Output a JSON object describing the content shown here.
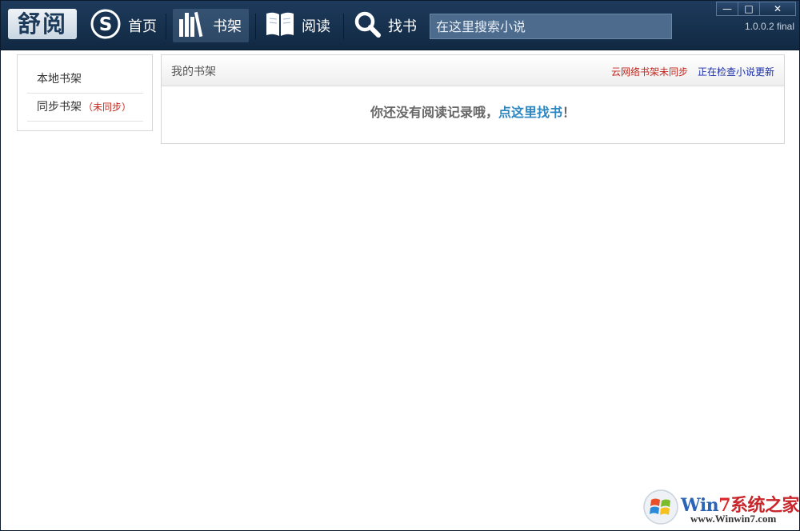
{
  "app": {
    "logo_text": "舒阅",
    "version": "1.0.0.2 final"
  },
  "nav": {
    "home": "首页",
    "shelf": "书架",
    "read": "阅读",
    "find": "找书"
  },
  "search": {
    "placeholder": "在这里搜索小说"
  },
  "window_controls": {
    "minimize": "—",
    "maximize": "□",
    "close": "✕"
  },
  "sidebar": {
    "items": [
      {
        "label": "本地书架"
      },
      {
        "label": "同步书架",
        "note": "（未同步）"
      }
    ]
  },
  "main": {
    "title": "我的书架",
    "cloud_status": "云网络书架未同步",
    "update_status": "正在检查小说更新",
    "empty_text": "你还没有阅读记录哦，",
    "empty_link": "点这里找书",
    "empty_suffix": "！"
  },
  "watermark": {
    "brand_prefix": "Win",
    "brand_number": "7",
    "brand_suffix": "系统之家",
    "url": "www.Winwin7.com"
  },
  "colors": {
    "topbar": "#17324f",
    "accent_link": "#2c86c0",
    "warning": "#c2281e",
    "update_link": "#1b2fa7"
  },
  "icons": {
    "home": "s-circle-icon",
    "shelf": "books-icon",
    "read": "open-book-icon",
    "find": "search-icon"
  }
}
